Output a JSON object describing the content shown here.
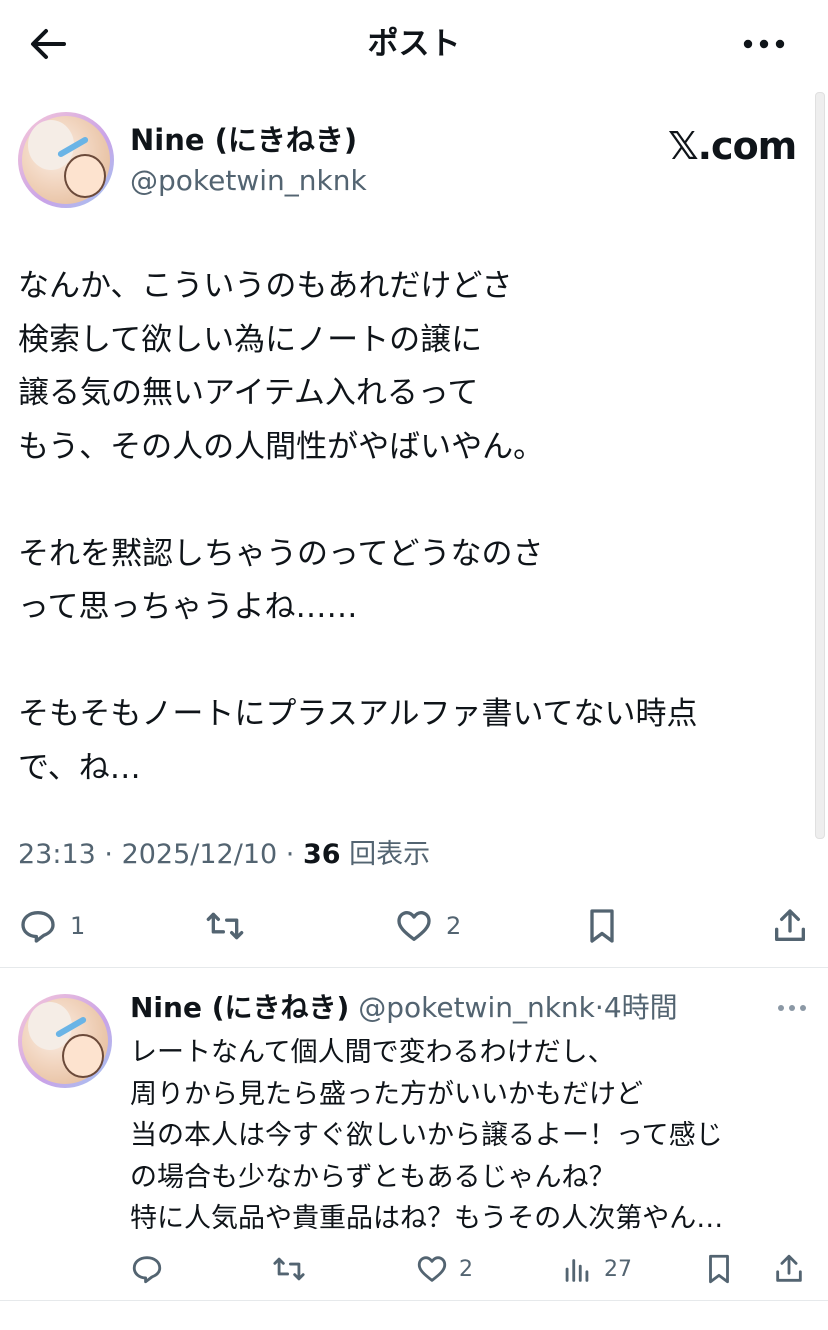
{
  "header": {
    "title": "ポスト"
  },
  "main_post": {
    "author_name": "Nine (にきねき)",
    "author_handle": "@poketwin_nknk",
    "watermark": "𝕏.com",
    "text": "なんか、こういうのもあれだけどさ\n検索して欲しい為にノートの譲に\n譲る気の無いアイテム入れるって\nもう、その人の人間性がやばいやん。\n\nそれを黙認しちゃうのってどうなのさ\nって思っちゃうよね……\n\nそもそもノートにプラスアルファ書いてない時点\nで、ね…",
    "meta": {
      "time": "23:13",
      "date": "2025/12/10",
      "sep": " · ",
      "views": "36",
      "views_label": " 回表示"
    },
    "actions": {
      "reply_count": "1",
      "like_count": "2"
    }
  },
  "reply": {
    "author_name": "Nine (にきねき)",
    "author_handle": "@poketwin_nknk",
    "time_ago": "4時間",
    "sep": "·",
    "text": "レートなんて個人間で変わるわけだし、\n周りから見たら盛った方がいいかもだけど\n当の本人は今すぐ欲しいから譲るよー！って感じ\nの場合も少なからずともあるじゃんね？\n特に人気品や貴重品はね？もうその人次第やん…",
    "actions": {
      "like_count": "2",
      "views_count": "27"
    }
  },
  "icons": [
    "back-arrow-icon",
    "more-dots-icon",
    "reply-icon",
    "retweet-icon",
    "like-icon",
    "bookmark-icon",
    "share-icon",
    "views-icon"
  ],
  "colors": {
    "text": "#0f1419",
    "secondary": "#536471",
    "divider": "#e6e9eb"
  }
}
